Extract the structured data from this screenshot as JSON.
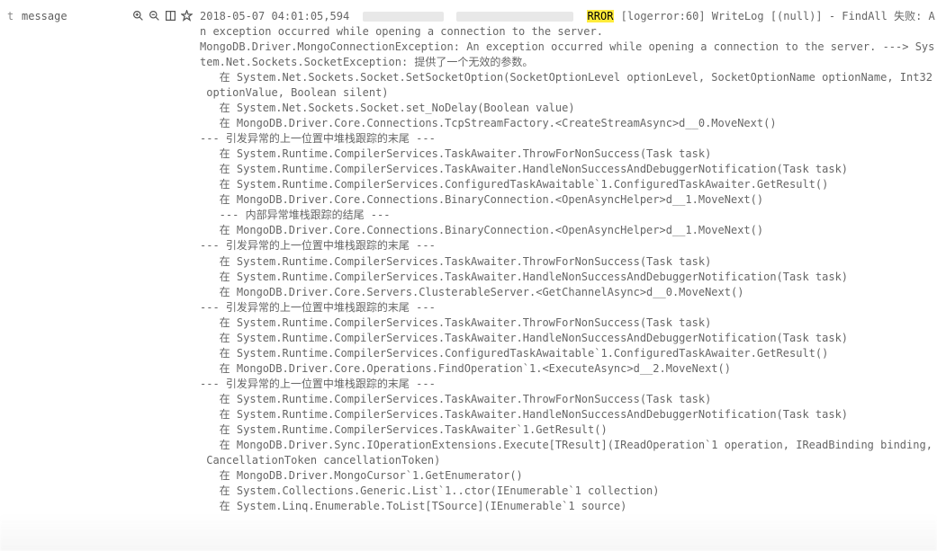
{
  "leftPanel": {
    "fieldType": "t",
    "fieldName": "message"
  },
  "toolbar": {
    "zoomIn": "zoom-in",
    "zoomOut": "zoom-out",
    "columns": "columns",
    "filter": "filter"
  },
  "log": {
    "timestamp": "2018-05-07 04:01:05,594",
    "levelFragment": "RROR",
    "header": " [logerror:60] WriteLog [(null)] - FindAll 失败: A",
    "lines": [
      "n exception occurred while opening a connection to the server.",
      "MongoDB.Driver.MongoConnectionException: An exception occurred while opening a connection to the server. ---> Sys",
      "tem.Net.Sockets.SocketException: 提供了一个无效的参数。",
      "   在 System.Net.Sockets.Socket.SetSocketOption(SocketOptionLevel optionLevel, SocketOptionName optionName, Int32",
      " optionValue, Boolean silent)",
      "   在 System.Net.Sockets.Socket.set_NoDelay(Boolean value)",
      "   在 MongoDB.Driver.Core.Connections.TcpStreamFactory.<CreateStreamAsync>d__0.MoveNext()",
      "--- 引发异常的上一位置中堆栈跟踪的末尾 ---",
      "   在 System.Runtime.CompilerServices.TaskAwaiter.ThrowForNonSuccess(Task task)",
      "   在 System.Runtime.CompilerServices.TaskAwaiter.HandleNonSuccessAndDebuggerNotification(Task task)",
      "   在 System.Runtime.CompilerServices.ConfiguredTaskAwaitable`1.ConfiguredTaskAwaiter.GetResult()",
      "   在 MongoDB.Driver.Core.Connections.BinaryConnection.<OpenAsyncHelper>d__1.MoveNext()",
      "   --- 内部异常堆栈跟踪的结尾 ---",
      "   在 MongoDB.Driver.Core.Connections.BinaryConnection.<OpenAsyncHelper>d__1.MoveNext()",
      "--- 引发异常的上一位置中堆栈跟踪的末尾 ---",
      "   在 System.Runtime.CompilerServices.TaskAwaiter.ThrowForNonSuccess(Task task)",
      "   在 System.Runtime.CompilerServices.TaskAwaiter.HandleNonSuccessAndDebuggerNotification(Task task)",
      "   在 MongoDB.Driver.Core.Servers.ClusterableServer.<GetChannelAsync>d__0.MoveNext()",
      "--- 引发异常的上一位置中堆栈跟踪的末尾 ---",
      "   在 System.Runtime.CompilerServices.TaskAwaiter.ThrowForNonSuccess(Task task)",
      "   在 System.Runtime.CompilerServices.TaskAwaiter.HandleNonSuccessAndDebuggerNotification(Task task)",
      "   在 System.Runtime.CompilerServices.ConfiguredTaskAwaitable`1.ConfiguredTaskAwaiter.GetResult()",
      "   在 MongoDB.Driver.Core.Operations.FindOperation`1.<ExecuteAsync>d__2.MoveNext()",
      "--- 引发异常的上一位置中堆栈跟踪的末尾 ---",
      "   在 System.Runtime.CompilerServices.TaskAwaiter.ThrowForNonSuccess(Task task)",
      "   在 System.Runtime.CompilerServices.TaskAwaiter.HandleNonSuccessAndDebuggerNotification(Task task)",
      "   在 System.Runtime.CompilerServices.TaskAwaiter`1.GetResult()",
      "   在 MongoDB.Driver.Sync.IOperationExtensions.Execute[TResult](IReadOperation`1 operation, IReadBinding binding,",
      " CancellationToken cancellationToken)",
      "   在 MongoDB.Driver.MongoCursor`1.GetEnumerator()",
      "   在 System.Collections.Generic.List`1..ctor(IEnumerable`1 collection)",
      "   在 System.Linq.Enumerable.ToList[TSource](IEnumerable`1 source)"
    ]
  }
}
